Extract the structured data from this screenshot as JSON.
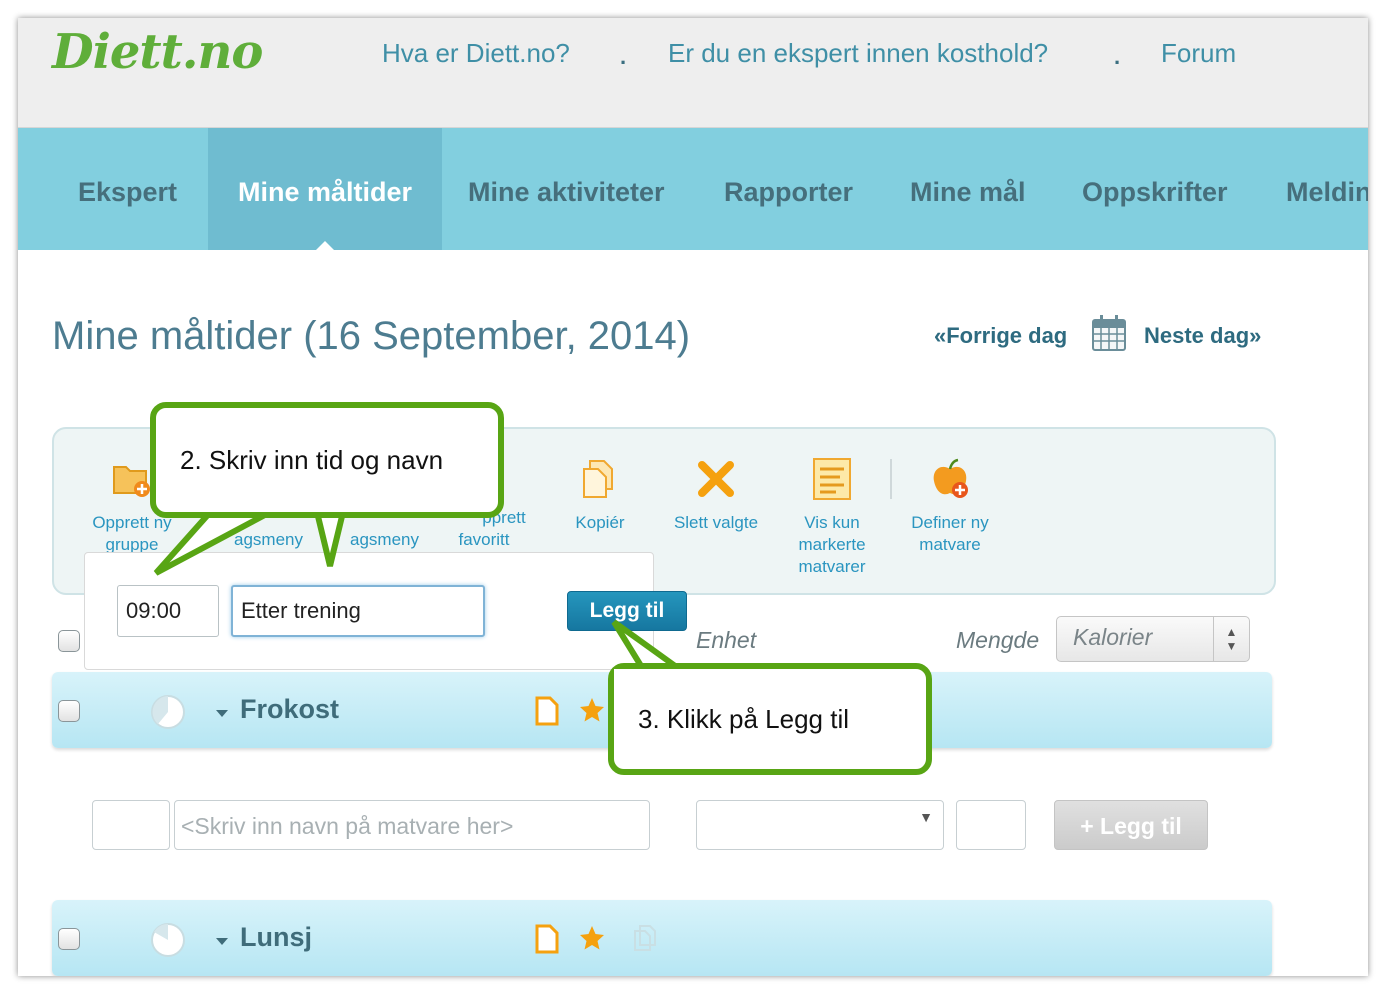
{
  "header": {
    "logo": "Diett.no",
    "links": [
      "Hva er Diett.no?",
      "Er du en ekspert innen kosthold?",
      "Forum"
    ],
    "separator": "."
  },
  "nav": {
    "items": [
      "Ekspert",
      "Mine måltider",
      "Mine aktiviteter",
      "Rapporter",
      "Mine mål",
      "Oppskrifter",
      "Meldin"
    ],
    "active": "Mine måltider"
  },
  "page": {
    "title": "Mine måltider (16 September, 2014)",
    "prev_day": "«Forrige dag",
    "next_day": "Neste dag»"
  },
  "toolbar": {
    "items": [
      {
        "label": "Opprett ny gruppe",
        "icon": "folder-add-icon"
      },
      {
        "label": "dagsmeny",
        "icon": "hidden"
      },
      {
        "label": "dagsmeny",
        "icon": "hidden"
      },
      {
        "label": "Opprett favoritt",
        "icon": "hidden"
      },
      {
        "label": "Kopiér",
        "icon": "copy-icon"
      },
      {
        "label": "Slett valgte",
        "icon": "delete-x-icon"
      },
      {
        "label": "Vis kun markerte matvarer",
        "icon": "list-icon"
      },
      {
        "label": "Definer ny matvare",
        "icon": "apple-add-icon"
      }
    ],
    "visible_fragments": {
      "opprett_ny_line1": "Opprett ny",
      "gruppe": "gruppe",
      "dagsmeny_1": "agsmeny",
      "dagsmeny_2": "agsmeny",
      "favoritt_line1": "pprett",
      "favoritt_line2": "favoritt",
      "kopier": "Kopiér",
      "slett": "Slett valgte",
      "vis_kun_1": "Vis kun",
      "vis_kun_2": "markerte",
      "vis_kun_3": "matvarer",
      "definer_1": "Definer ny",
      "definer_2": "matvare"
    }
  },
  "group_popup": {
    "time_value": "09:00",
    "name_value": "Etter trening",
    "button": "Legg til"
  },
  "columns": {
    "enhet": "Enhet",
    "mengde": "Mengde",
    "kalorier": "Kalorier"
  },
  "meals": [
    {
      "name": "Frokost"
    },
    {
      "name": "Lunsj"
    }
  ],
  "food_entry": {
    "placeholder": "<Skriv inn navn på matvare her>",
    "add_button": "+ Legg til"
  },
  "callouts": {
    "step2": "2. Skriv inn tid og navn",
    "step3": "3. Klikk på Legg til"
  },
  "colors": {
    "brand_green": "#5fae3a",
    "nav_bg": "#82cfdf",
    "nav_active": "#6fbcd0",
    "link_blue": "#2a95c0",
    "callout_border": "#58a514",
    "button_blue": "#1d86b0"
  }
}
